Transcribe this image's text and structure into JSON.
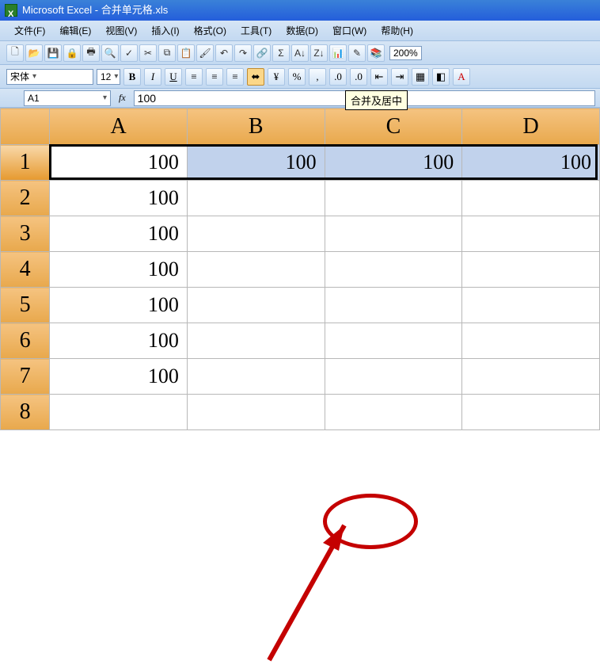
{
  "titlebar": {
    "app": "Microsoft Excel",
    "sep": " - ",
    "doc": "合并单元格.xls"
  },
  "menus": {
    "file": "文件(F)",
    "edit": "编辑(E)",
    "view": "视图(V)",
    "insert": "插入(I)",
    "format": "格式(O)",
    "tools": "工具(T)",
    "data": "数据(D)",
    "window": "窗口(W)",
    "help": "帮助(H)"
  },
  "toolbar": {
    "zoom": "200%"
  },
  "format_bar": {
    "font_name": "宋体",
    "font_size": "12",
    "bold": "B",
    "italic": "I",
    "underline": "U",
    "currency": "%",
    "comma": ",",
    "merge_tooltip": "合并及居中"
  },
  "namebox": {
    "cell_ref": "A1",
    "fx": "fx",
    "formula": "100"
  },
  "grid": {
    "columns": [
      "A",
      "B",
      "C",
      "D"
    ],
    "rows": [
      "1",
      "2",
      "3",
      "4",
      "5",
      "6",
      "7",
      "8"
    ],
    "cells": {
      "r1": {
        "A": "100",
        "B": "100",
        "C": "100",
        "D": "100"
      },
      "r2": {
        "A": "100"
      },
      "r3": {
        "A": "100"
      },
      "r4": {
        "A": "100"
      },
      "r5": {
        "A": "100"
      },
      "r6": {
        "A": "100"
      },
      "r7": {
        "A": "100"
      }
    }
  },
  "chart_data": {
    "type": "table",
    "columns": [
      "A",
      "B",
      "C",
      "D"
    ],
    "rows": [
      [
        100,
        100,
        100,
        100
      ],
      [
        100,
        null,
        null,
        null
      ],
      [
        100,
        null,
        null,
        null
      ],
      [
        100,
        null,
        null,
        null
      ],
      [
        100,
        null,
        null,
        null
      ],
      [
        100,
        null,
        null,
        null
      ],
      [
        100,
        null,
        null,
        null
      ],
      [
        null,
        null,
        null,
        null
      ]
    ],
    "active_cell": "A1",
    "selection": "A1:D1"
  }
}
